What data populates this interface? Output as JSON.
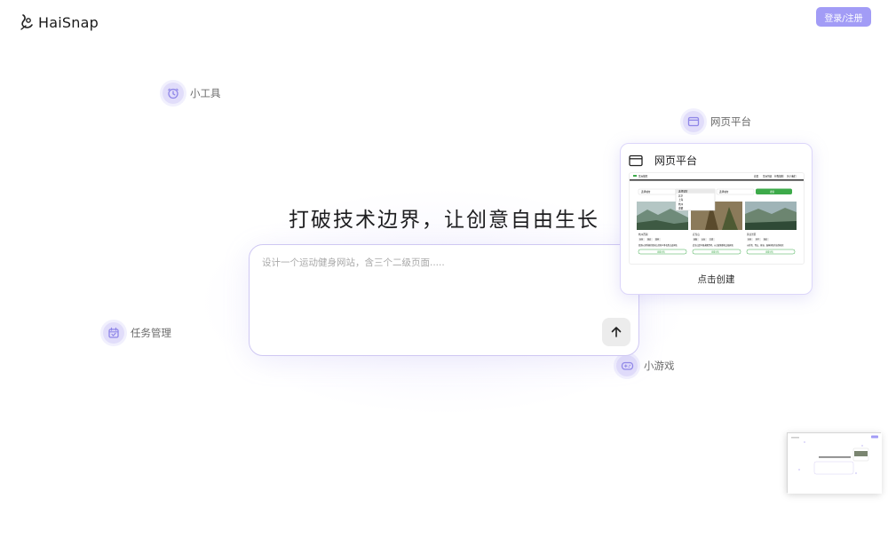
{
  "header": {
    "logo_text": "HaiSnap",
    "login_label": "登录/注册"
  },
  "hero": {
    "title": "打破技术边界，让创意自由生长"
  },
  "prompt": {
    "placeholder": "设计一个运动健身网站，含三个二级页面....."
  },
  "chips": {
    "tools": {
      "label": "小工具",
      "icon": "clock-icon"
    },
    "web": {
      "label": "网页平台",
      "icon": "browser-window-icon"
    },
    "tasks": {
      "label": "任务管理",
      "icon": "calendar-check-icon"
    },
    "games": {
      "label": "小游戏",
      "icon": "gamepad-icon"
    }
  },
  "card": {
    "title": "网页平台",
    "create_label": "点击创建",
    "preview": {
      "site_name": "景点推荐",
      "nav": [
        "首页",
        "景点列表",
        "行程规划",
        "关于我们"
      ],
      "select_value": "选择城市",
      "dropdown_options": [
        "选择城市",
        "北京",
        "上海",
        "杭州",
        "成都"
      ],
      "search_button": "搜索",
      "spots": [
        {
          "name": "杭州西湖",
          "tags": [
            "自然",
            "湖泊",
            "园林"
          ],
          "desc": "西湖以其秀丽的湖光山色和众多名胜古迹闻名",
          "button": "查看详情"
        },
        {
          "name": "武当山",
          "tags": [
            "道教",
            "山岳",
            "古建"
          ],
          "desc": "武当山是中国道教圣地，以古建筑群和太极闻名",
          "button": "查看详情"
        },
        {
          "name": "黄龙景区",
          "tags": [
            "自然",
            "钙华",
            "湖泊"
          ],
          "desc": "以彩池、雪山、峡谷、森林闻名的自然景区",
          "button": "查看详情"
        }
      ]
    }
  },
  "colors": {
    "accent": "#a29cf6",
    "chip_bg": "#e1ddfa",
    "card_border": "#dcd6fa",
    "green": "#3daa4a"
  }
}
